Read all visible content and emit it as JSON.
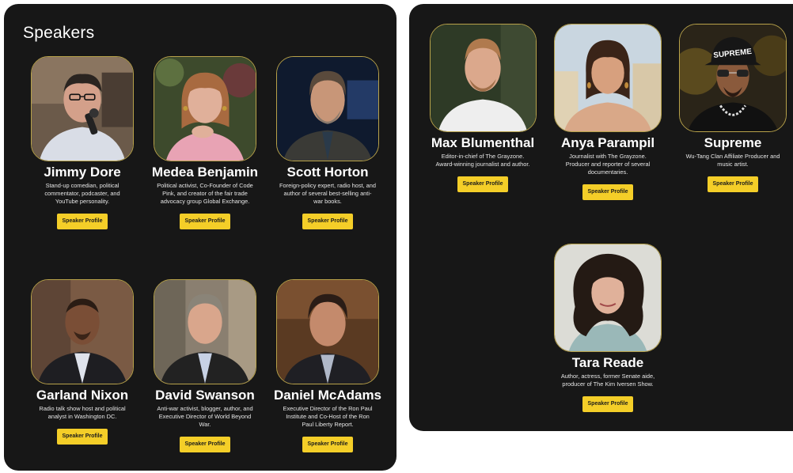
{
  "section_title": "Speakers",
  "button_label": "Speaker Profile",
  "speakers": [
    {
      "name": "Jimmy Dore",
      "desc": "Stand-up comedian, political commentator, podcaster, and YouTube personality."
    },
    {
      "name": "Medea Benjamin",
      "desc": "Political activist, Co-Founder of Code Pink, and creator of the fair trade advocacy group Global Exchange."
    },
    {
      "name": "Scott Horton",
      "desc": "Foreign-policy expert, radio host, and author of several best-selling anti-war books."
    },
    {
      "name": "Garland Nixon",
      "desc": "Radio talk show host and political analyst in Washington DC."
    },
    {
      "name": "David Swanson",
      "desc": "Anti-war activist, blogger, author, and Executive Director of World Beyond War."
    },
    {
      "name": "Daniel McAdams",
      "desc": "Executive Director of the Ron Paul Institute and Co-Host of the Ron Paul Liberty Report."
    },
    {
      "name": "Max Blumenthal",
      "desc": "Editor-in-chief of The Grayzone. Award-winning journalist and author."
    },
    {
      "name": "Anya Parampil",
      "desc": "Journalist with The Grayzone. Producer and reporter of several documentaries."
    },
    {
      "name": "Supreme",
      "desc": "Wu-Tang Clan Affiliate Producer and music artist."
    },
    {
      "name": "Tara Reade",
      "desc": "Author, actress, former Senate aide, producer of The Kim Iversen Show."
    }
  ],
  "cap_text": "SUPREME",
  "colors": {
    "panel": "#171717",
    "accent": "#f4ce28",
    "frame": "#b8a24a"
  }
}
